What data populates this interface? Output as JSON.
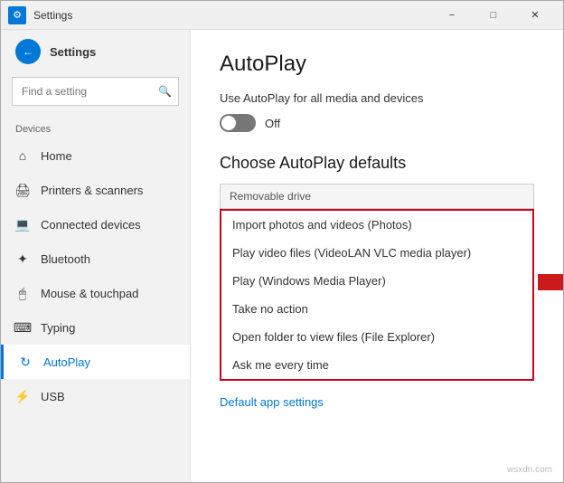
{
  "window": {
    "title": "Settings",
    "icon_char": "⚙"
  },
  "titlebar": {
    "minimize_label": "−",
    "maximize_label": "□",
    "close_label": "✕"
  },
  "sidebar": {
    "app_title": "Settings",
    "search_placeholder": "Find a setting",
    "section_label": "Devices",
    "back_icon": "←",
    "search_icon": "🔍",
    "items": [
      {
        "id": "home",
        "label": "Home",
        "icon": "⌂"
      },
      {
        "id": "printers",
        "label": "Printers & scanners",
        "icon": "🖨"
      },
      {
        "id": "connected-devices",
        "label": "Connected devices",
        "icon": "💻"
      },
      {
        "id": "bluetooth",
        "label": "Bluetooth",
        "icon": "✦"
      },
      {
        "id": "mouse",
        "label": "Mouse & touchpad",
        "icon": "🖱"
      },
      {
        "id": "typing",
        "label": "Typing",
        "icon": "⌨"
      },
      {
        "id": "autoplay",
        "label": "AutoPlay",
        "icon": "↻",
        "active": true
      },
      {
        "id": "usb",
        "label": "USB",
        "icon": "⚡"
      }
    ]
  },
  "content": {
    "title": "AutoPlay",
    "description": "Use AutoPlay for all media and devices",
    "toggle_state": "Off",
    "section_title": "Choose AutoPlay defaults",
    "dropdown_header": "Removable drive",
    "options": [
      {
        "id": "import-photos",
        "label": "Import photos and videos (Photos)"
      },
      {
        "id": "play-video",
        "label": "Play video files (VideoLAN VLC media player)"
      },
      {
        "id": "play-wmp",
        "label": "Play (Windows Media Player)"
      },
      {
        "id": "no-action",
        "label": "Take no action"
      },
      {
        "id": "open-folder",
        "label": "Open folder to view files (File Explorer)"
      },
      {
        "id": "ask-me",
        "label": "Ask me every time"
      }
    ],
    "default_app_link": "Default app settings"
  },
  "watermark": "wsxdn.com",
  "colors": {
    "accent": "#0078d7",
    "border_red": "#d0021b",
    "arrow_red": "#cc1a1a"
  }
}
